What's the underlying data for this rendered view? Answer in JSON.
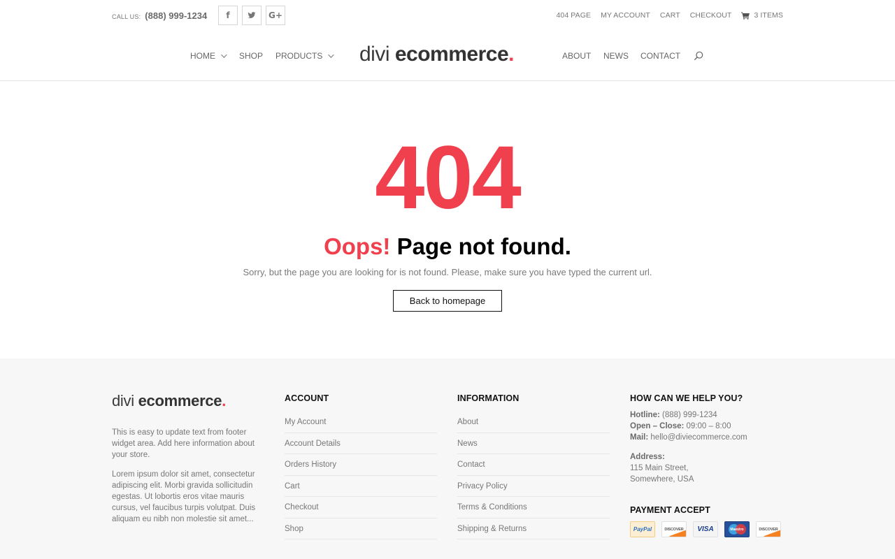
{
  "topbar": {
    "call_label": "CALL US:",
    "phone": "(888) 999-1234",
    "socials": [
      {
        "icon": "facebook-icon",
        "glyph": "f"
      },
      {
        "icon": "twitter-icon",
        "glyph": "t"
      },
      {
        "icon": "google-plus-icon",
        "glyph": "G+"
      }
    ],
    "links": [
      "404 PAGE",
      "MY ACCOUNT",
      "CART",
      "CHECKOUT"
    ],
    "cart_label": "3 ITEMS"
  },
  "nav": {
    "left": [
      {
        "label": "HOME",
        "dropdown": true
      },
      {
        "label": "SHOP",
        "dropdown": false
      },
      {
        "label": "PRODUCTS",
        "dropdown": true
      }
    ],
    "logo": {
      "thin": "divi",
      "bold": "ecommerce",
      "dot": "."
    },
    "right": [
      {
        "label": "ABOUT"
      },
      {
        "label": "NEWS"
      },
      {
        "label": "CONTACT"
      }
    ]
  },
  "error": {
    "code": "404",
    "oops": "Oops!",
    "title": "Page not found.",
    "message": "Sorry, but the page you are looking for is not found. Please, make sure you have typed the current url.",
    "button": "Back to homepage"
  },
  "footer": {
    "logo": {
      "thin": "divi",
      "bold": "ecommerce",
      "dot": "."
    },
    "about_text_1": "This is easy to update text from footer widget area. Add here information about your store.",
    "about_text_2": "Lorem ipsum dolor sit amet, consectetur adipiscing elit. Morbi gravida sollicitudin egestas. Ut lobortis eros vitae mauris cursus, vel faucibus turpis volutpat. Duis aliquam eu nibh non molestie sit amet...",
    "account": {
      "title": "ACCOUNT",
      "items": [
        "My Account",
        "Account Details",
        "Orders History",
        "Cart",
        "Checkout",
        "Shop"
      ]
    },
    "information": {
      "title": "INFORMATION",
      "items": [
        "About",
        "News",
        "Contact",
        "Privacy Policy",
        "Terms & Conditions",
        "Shipping & Returns"
      ]
    },
    "help": {
      "title": "HOW CAN WE HELP YOU?",
      "hotline_label": "Hotline:",
      "hotline": "(888) 999-1234",
      "hours_label": "Open – Close:",
      "hours": "09:00 – 8:00",
      "mail_label": "Mail:",
      "mail": "hello@diviecommerce.com",
      "address_label": "Address:",
      "address_line1": "115 Main Street,",
      "address_line2": "Somewhere, USA"
    },
    "payment": {
      "title": "PAYMENT ACCEPT",
      "cards": [
        "PayPal",
        "DISCOVER",
        "VISA",
        "Maestro",
        "DISCOVER"
      ]
    }
  },
  "colors": {
    "accent": "#f0404e",
    "footer_bg": "#f7f7f7",
    "text_muted": "#777777"
  }
}
